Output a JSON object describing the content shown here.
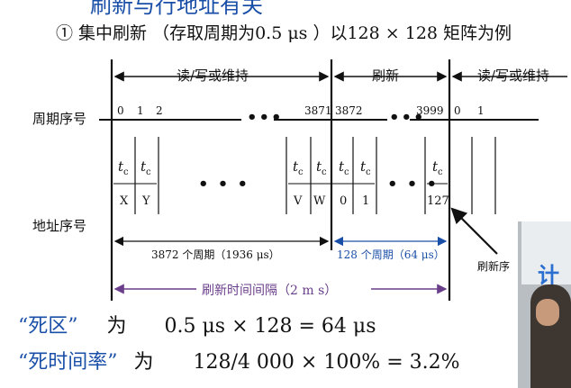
{
  "slide": {
    "top_title_partial": "刷新与行地址有关",
    "heading": "① 集中刷新  （存取周期为0.5 μs ）以128 × 128 矩阵为例",
    "labels": {
      "cycle_seq": "周期序号",
      "addr_seq": "地址序号"
    },
    "segments": {
      "rw1": "读/写或维持",
      "refresh": "刷新",
      "rw2": "读/写或维持"
    },
    "cycle_numbers": {
      "n0": "0",
      "n1": "1",
      "n2": "2",
      "n3871": "3871",
      "n3872": "3872",
      "n3999": "3999",
      "m0": "0",
      "m1": "1"
    },
    "ellipsis": "•••",
    "ellipsis_small": "• • •",
    "tc_main": "t",
    "tc_sub": "c",
    "addr": {
      "x": "X",
      "y": "Y",
      "v": "V",
      "w": "W",
      "r0": "0",
      "r1": "1",
      "r127": "127"
    },
    "span_rw": "3872 个周期（1936 μs）",
    "span_refresh": "128 个周期（64 μs）",
    "refresh_interval": "刷新时间间隔（2 m s）",
    "refresh_seq_partial": "刷新序",
    "dead_zone_label": "“死区”",
    "dead_zone_word": "为",
    "dead_zone_eq": "0.5 μs × 128 = 64 μs",
    "dead_rate_label": "“死时间率”",
    "dead_rate_word": "为",
    "dead_rate_eq": "128/4 000 × 100% = 3.2%",
    "video_glyph": "计"
  },
  "colors": {
    "blue": "#1a4fa8",
    "purple": "#6a3e8a",
    "brown": "#7a1c2a",
    "black": "#111111"
  }
}
